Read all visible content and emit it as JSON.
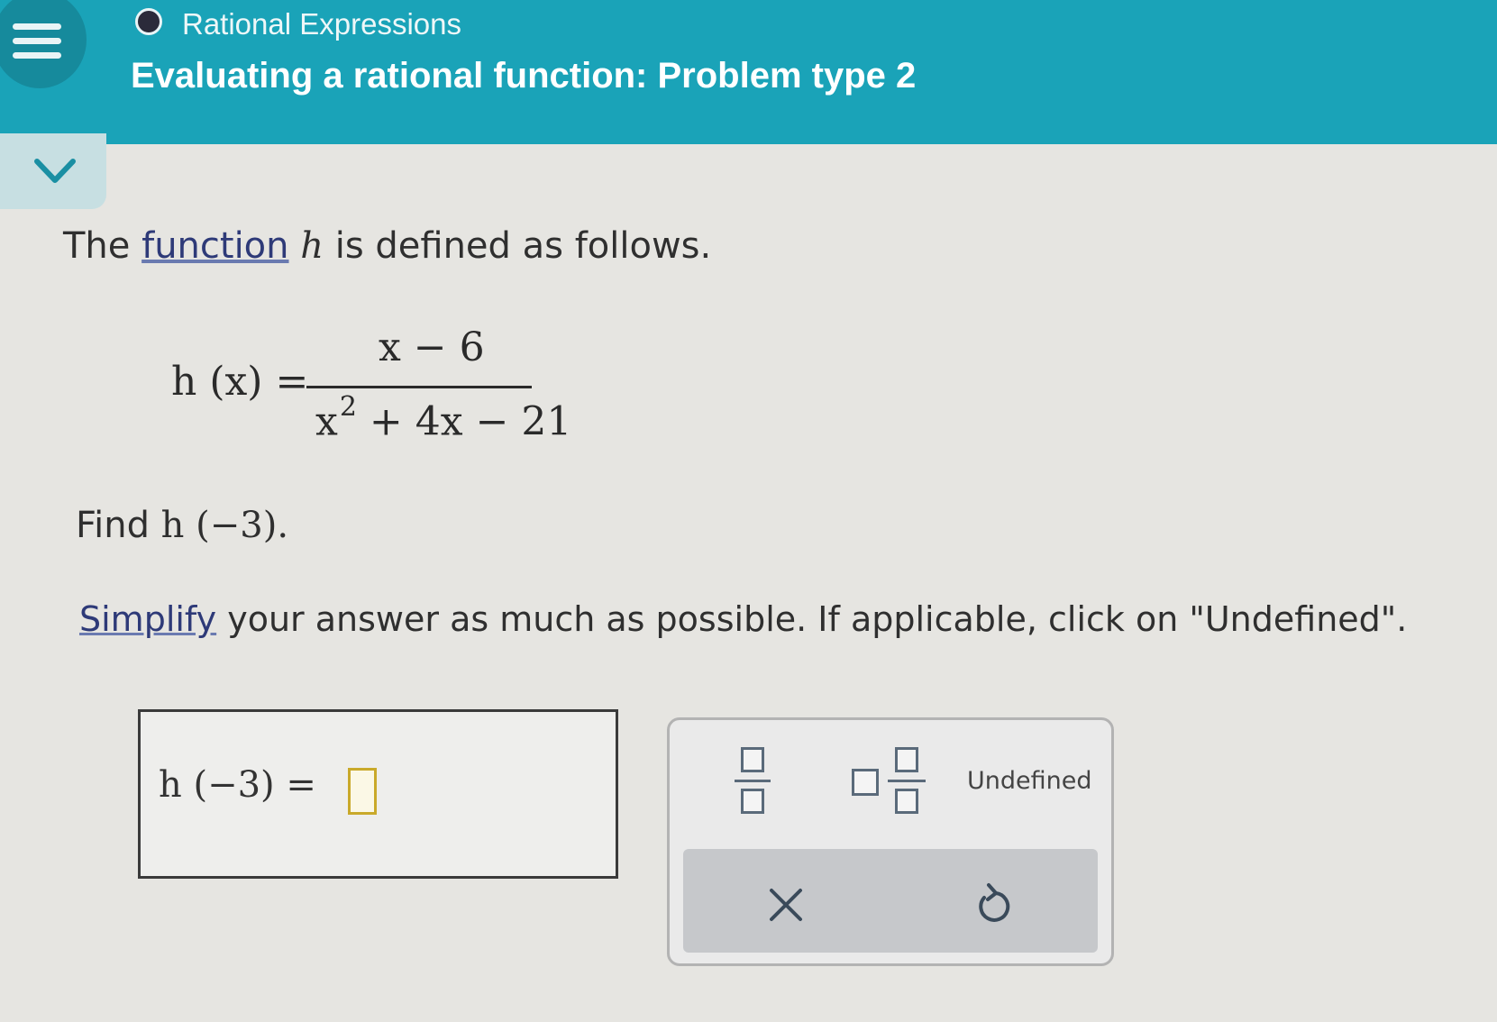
{
  "header": {
    "topic": "Rational Expressions",
    "title": "Evaluating a rational function: Problem type 2"
  },
  "problem": {
    "intro_before": "The ",
    "intro_link": "function",
    "intro_var": "h",
    "intro_after": " is defined as follows.",
    "equation": {
      "lhs": "h (x) =",
      "numerator": "x − 6",
      "den_x": "x",
      "den_exp": "2",
      "den_rest": "+ 4x − 21"
    },
    "find_prefix": "Find ",
    "find_expr": "h (−3).",
    "instruction_link": "Simplify",
    "instruction_rest": " your answer as much as possible. If applicable, click on \"Undefined\"."
  },
  "answer": {
    "expression": "h (−3)  ="
  },
  "keypad": {
    "undefined_label": "Undefined",
    "clear_symbol": "×",
    "undo_symbol": "↺"
  }
}
